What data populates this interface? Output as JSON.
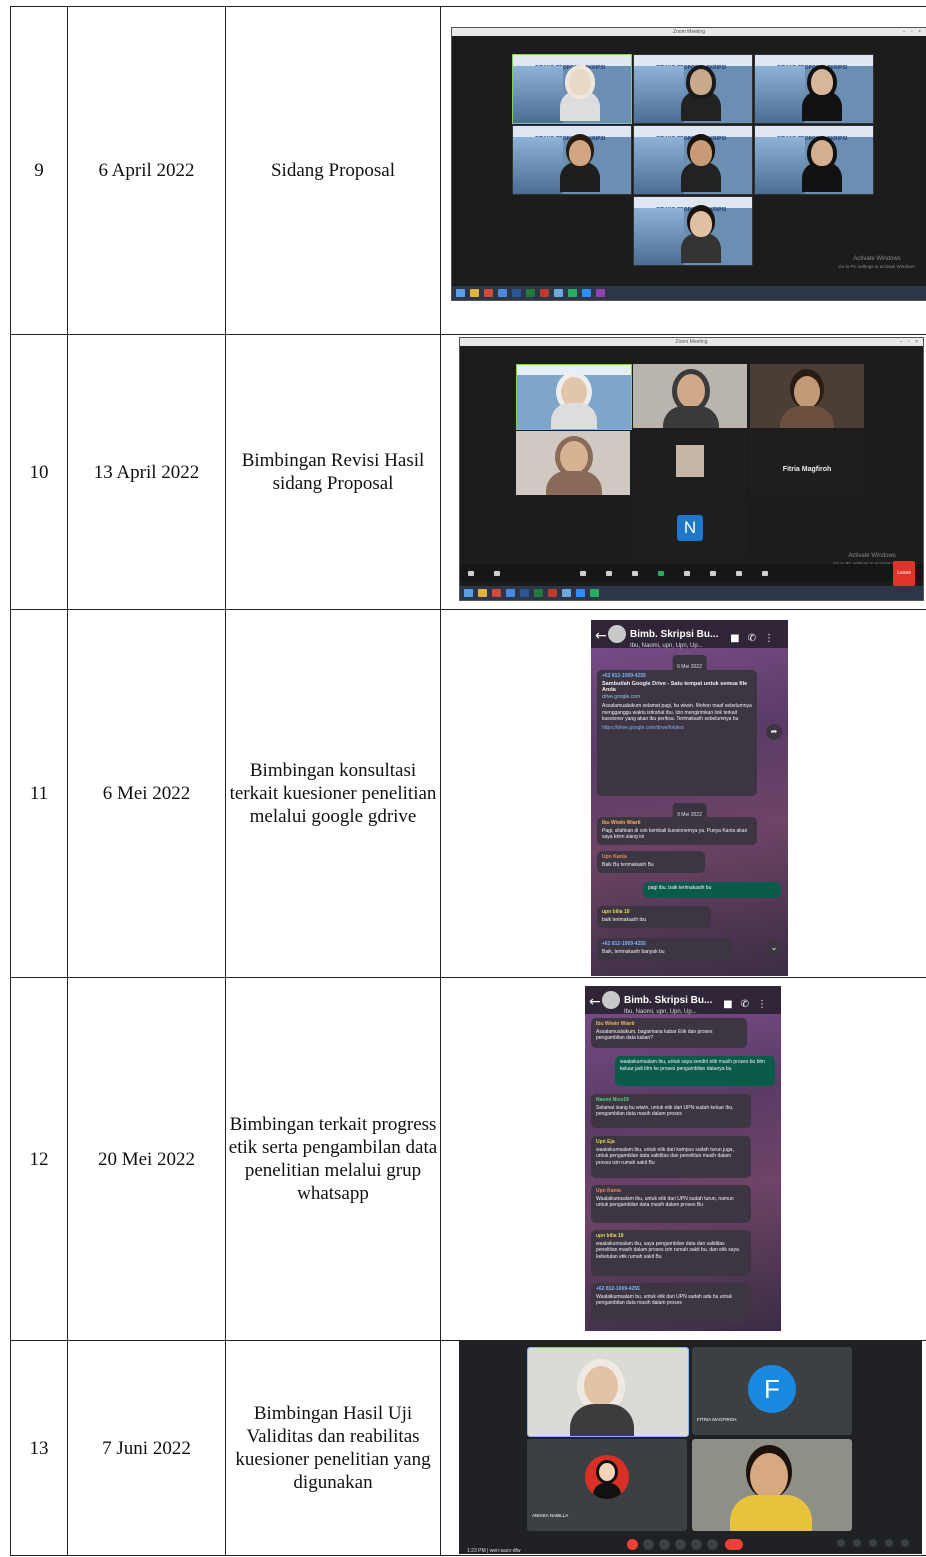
{
  "rows": [
    {
      "no": "9",
      "date": "6 April 2022",
      "activity": "Sidang Proposal",
      "screenshot": {
        "app": "Zoom Meeting",
        "window_title": "Zoom Meeting",
        "slide_text": "SIDANG PROPOSAL SKRIPSI",
        "watermark_line1": "Activate Windows",
        "watermark_line2": "Go to PC settings to activate Windows."
      }
    },
    {
      "no": "10",
      "date": "13 April 2022",
      "activity": "Bimbingan Revisi Hasil sidang Proposal",
      "screenshot": {
        "app": "Zoom Meeting",
        "window_title": "Zoom Meeting",
        "participant_name": "Fitria Magfiroh",
        "avatar_initial": "N",
        "watermark_line1": "Activate Windows",
        "watermark_line2": "Go to PC settings to activate Windows.",
        "leave_label": "Leave"
      }
    },
    {
      "no": "11",
      "date": "6 Mei 2022",
      "activity": "Bimbingan konsultasi terkait kuesioner penelitian melalui google gdrive",
      "screenshot": {
        "app": "WhatsApp",
        "chat_title": "Bimb. Skripsi Bu...",
        "chat_members": "Ibu, Naomi, upn, Upn, Up...",
        "date_1": "6 Mei 2022",
        "message_1_sender": "+62 812-1009-4255",
        "message_1_text": "Sambutlah Google Drive - Satu tempat untuk semua file Anda",
        "message_1_link": "drive.google.com",
        "message_1_body": "Assalamualaikum selamat pagi, bu wiwin. Mohon maaf sebelumnya mengganggu waktu istirahat ibu. Izin mengirimkan link terkait kuesioner yang akan ibu periksa. Terimakasih sebelumnya bu",
        "message_1_url": "https://drive.google.com/drive/folders",
        "date_2": "9 Mei 2022",
        "message_2_sender": "Ibu Wiwin Wiarti",
        "message_2_text": "Pagi, silahkan di cek kembali kuesionernya ya. Punya Kania akan saya kirim siang ini",
        "message_3_sender": "Upn Kania",
        "message_3_text": "Baik Bu terimakasih Bu",
        "message_4_text": "pagi ibu, baik terimakasih bu",
        "message_5_sender": "upn bilia 18",
        "message_5_text": "baik terimakasih ibu",
        "message_6_sender": "+62 812-1009-4255",
        "message_6_text": "Baik, terimakasih banyak bu"
      }
    },
    {
      "no": "12",
      "date": "20 Mei 2022",
      "activity": "Bimbingan terkait progress etik serta pengambilan data penelitian melalui grup whatsapp",
      "screenshot": {
        "app": "WhatsApp",
        "chat_title": "Bimb. Skripsi Bu...",
        "chat_members": "Ibu, Naomi, upn, Upn, Up...",
        "message_1_sender": "Ibu Wiwin Wiarti",
        "message_1_text": "Assalamualaikum, bagaimana kabar Etik dan proses pengambilan data kalian?",
        "message_2_text": "waalaikumsalam ibu, untuk saya sendiri etik masih proses bu blm keluar jadi blm ke proses pengambilan datanya bu",
        "message_3_sender": "Naomi Nice19",
        "message_3_text": "Selamat siang bu wiwin, untuk etik dari UPN sudah keluar ibu, pengambilan data masih dalam proses",
        "message_4_sender": "Upn Eja",
        "message_4_text": "waalaikumsalam ibu, untuk etik dari kampus sudah turun juga, untuk pengambilan data validitas dan penelitian masih dalam proses izin rumah sakit Bu",
        "message_5_sender": "Upn Kania",
        "message_5_text": "Waalaikumsalam ibu, untuk etik dari UPN sudah turun, namun untuk pengambilan data masih dalam proses Bu",
        "message_6_sender": "upn bilia 18",
        "message_6_text": "waalaikumsalam ibu, saya pengambilan data dan validitas penelitian masih dalam proses izin rumah sakit bu, dan etik saya kebetulan etik rumah sakit Bu",
        "message_7_sender": "+62 812-1009-4255",
        "message_7_text": "Waalaikumsalam bu, untuk etik dari UPN sudah ada bu untuk pengambilan data masih dalam proses"
      }
    },
    {
      "no": "13",
      "date": "7 Juni 2022",
      "activity": "Bimbingan Hasil Uji Validitas dan reabilitas kuesioner penelitian yang digunakan",
      "screenshot": {
        "app": "Google Meet",
        "avatar_initial": "F",
        "participant_1": "FITRIA MAGFIROH",
        "participant_2": "ANNISA NABILLA",
        "meeting_time": "1:23 PM",
        "meeting_code": "wen-sazo-dfw"
      }
    }
  ]
}
